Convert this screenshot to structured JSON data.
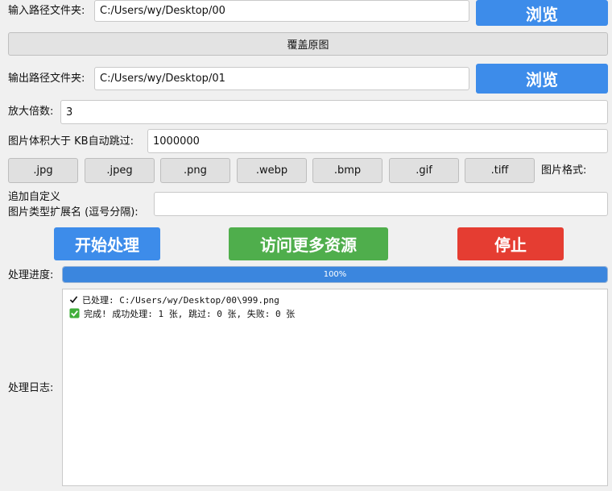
{
  "input_folder": {
    "label": "输入路径文件夹:",
    "value": "C:/Users/wy/Desktop/00"
  },
  "browse_input_label": "浏览",
  "overwrite_label": "覆盖原图",
  "output_folder": {
    "label": "输出路径文件夹:",
    "value": "C:/Users/wy/Desktop/01"
  },
  "browse_output_label": "浏览",
  "scale": {
    "label": "放大倍数:",
    "value": "3"
  },
  "skip_size": {
    "label": "图片体积大于 KB自动跳过:",
    "value": "1000000"
  },
  "formats": [
    ".jpg",
    ".jpeg",
    ".png",
    ".webp",
    ".bmp",
    ".gif",
    ".tiff"
  ],
  "formats_label": "图片格式:",
  "custom_ext": {
    "label_line1": "追加自定义",
    "label_line2": "图片类型扩展名 (逗号分隔):",
    "value": ""
  },
  "actions": {
    "start": "开始处理",
    "more": "访问更多资源",
    "stop": "停止"
  },
  "progress": {
    "label": "处理进度:",
    "text": "100%",
    "value": 1.0
  },
  "log": {
    "label": "处理日志:",
    "lines": [
      {
        "icon": "checkmark-icon",
        "text": "已处理: C:/Users/wy/Desktop/00\\999.png"
      },
      {
        "icon": "green-check-box-icon",
        "text": "完成! 成功处理: 1 张, 跳过: 0 张, 失败: 0 张"
      }
    ]
  },
  "colors": {
    "blue_button": "#3d8cea",
    "green_button": "#4fae4c",
    "red_button": "#e53d32",
    "progress_fill": "#3b86de"
  }
}
